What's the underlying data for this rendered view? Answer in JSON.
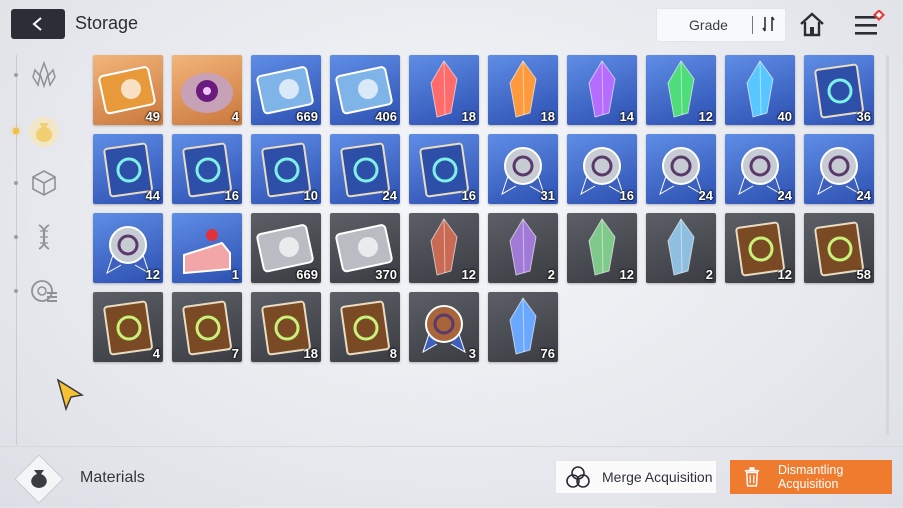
{
  "header": {
    "back_icon": "back-arrow-icon",
    "title": "Storage",
    "sort": {
      "label": "Grade",
      "icon": "sort-order-icon"
    },
    "home_icon": "home-icon",
    "menu_icon": "hamburger-menu-icon",
    "menu_badge_color": "#e23b3b"
  },
  "sidebar": {
    "tabs": [
      {
        "name": "crystal-tab",
        "icon": "crystal-cluster-icon",
        "active": false
      },
      {
        "name": "materials-tab",
        "icon": "pouch-icon",
        "active": true
      },
      {
        "name": "cube-tab",
        "icon": "cube-icon",
        "active": false
      },
      {
        "name": "gene-tab",
        "icon": "dna-helix-icon",
        "active": false
      },
      {
        "name": "module-tab",
        "icon": "module-chip-icon",
        "active": false
      }
    ]
  },
  "items": [
    {
      "kind": "ticket-gold",
      "count": "49",
      "frame": "gold"
    },
    {
      "kind": "eye-core",
      "count": "4",
      "frame": "gold"
    },
    {
      "kind": "ticket-blue",
      "count": "669",
      "frame": "blue"
    },
    {
      "kind": "ticket-blue2",
      "count": "406",
      "frame": "blue"
    },
    {
      "kind": "crystal-red",
      "count": "18",
      "frame": "blue"
    },
    {
      "kind": "crystal-orange",
      "count": "18",
      "frame": "blue"
    },
    {
      "kind": "crystal-purple",
      "count": "14",
      "frame": "blue"
    },
    {
      "kind": "crystal-green",
      "count": "12",
      "frame": "blue"
    },
    {
      "kind": "crystal-cyan",
      "count": "40",
      "frame": "blue"
    },
    {
      "kind": "book-blue-x",
      "count": "36",
      "frame": "blue"
    },
    {
      "kind": "book-blue-shield",
      "count": "44",
      "frame": "blue"
    },
    {
      "kind": "book-blue-eye",
      "count": "16",
      "frame": "blue"
    },
    {
      "kind": "book-blue-wing",
      "count": "10",
      "frame": "blue"
    },
    {
      "kind": "book-blue-target",
      "count": "24",
      "frame": "blue"
    },
    {
      "kind": "book-blue-circle",
      "count": "16",
      "frame": "blue"
    },
    {
      "kind": "medal-blue-1",
      "count": "31",
      "frame": "blue"
    },
    {
      "kind": "medal-blue-2",
      "count": "16",
      "frame": "blue"
    },
    {
      "kind": "medal-blue-3",
      "count": "24",
      "frame": "blue"
    },
    {
      "kind": "medal-blue-4",
      "count": "24",
      "frame": "blue"
    },
    {
      "kind": "medal-blue-5",
      "count": "24",
      "frame": "blue"
    },
    {
      "kind": "medal-blue-6",
      "count": "12",
      "frame": "blue"
    },
    {
      "kind": "cake",
      "count": "1",
      "frame": "blue"
    },
    {
      "kind": "ticket-gray",
      "count": "669",
      "frame": "gray"
    },
    {
      "kind": "ticket-gray2",
      "count": "370",
      "frame": "gray"
    },
    {
      "kind": "crystal-dull-red",
      "count": "12",
      "frame": "gray"
    },
    {
      "kind": "crystal-dull-purple",
      "count": "2",
      "frame": "gray"
    },
    {
      "kind": "crystal-dull-green",
      "count": "12",
      "frame": "gray"
    },
    {
      "kind": "crystal-dull-cyan",
      "count": "2",
      "frame": "gray"
    },
    {
      "kind": "book-brown-x",
      "count": "12",
      "frame": "gray"
    },
    {
      "kind": "book-brown-shield",
      "count": "58",
      "frame": "gray"
    },
    {
      "kind": "book-brown-eye",
      "count": "4",
      "frame": "gray"
    },
    {
      "kind": "book-brown-wing",
      "count": "7",
      "frame": "gray"
    },
    {
      "kind": "book-brown-target",
      "count": "18",
      "frame": "gray"
    },
    {
      "kind": "book-brown-circle",
      "count": "8",
      "frame": "gray"
    },
    {
      "kind": "medal-bronze",
      "count": "3",
      "frame": "gray"
    },
    {
      "kind": "crystal-prism",
      "count": "76",
      "frame": "gray"
    }
  ],
  "footer": {
    "category_icon": "pouch-icon",
    "category_label": "Materials",
    "merge": {
      "label": "Merge Acquisition",
      "icon": "merge-circles-icon"
    },
    "dismantle": {
      "label": "Dismantling Acquisition",
      "icon": "trash-icon",
      "color": "#ee7b2e"
    }
  }
}
